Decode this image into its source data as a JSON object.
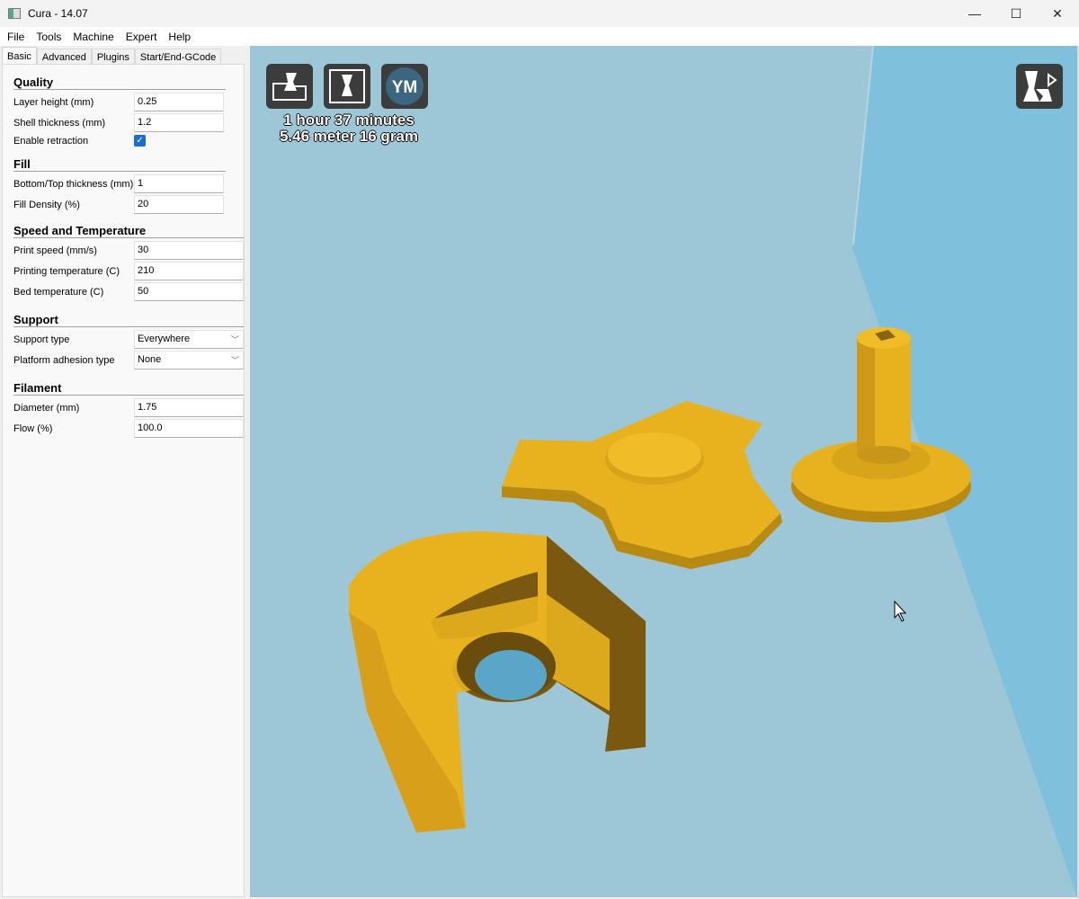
{
  "window": {
    "title": "Cura - 14.07",
    "minimize": "—",
    "maximize": "☐",
    "close": "✕"
  },
  "menu": [
    "File",
    "Tools",
    "Machine",
    "Expert",
    "Help"
  ],
  "tabs": [
    "Basic",
    "Advanced",
    "Plugins",
    "Start/End-GCode"
  ],
  "sections": {
    "quality": {
      "title": "Quality",
      "layer_height_label": "Layer height (mm)",
      "layer_height": "0.25",
      "shell_label": "Shell thickness (mm)",
      "shell": "1.2",
      "retraction_label": "Enable retraction",
      "retraction": true
    },
    "fill": {
      "title": "Fill",
      "bottom_top_label": "Bottom/Top thickness (mm)",
      "bottom_top": "1",
      "density_label": "Fill Density (%)",
      "density": "20"
    },
    "speed": {
      "title": "Speed and Temperature",
      "print_speed_label": "Print speed (mm/s)",
      "print_speed": "30",
      "print_temp_label": "Printing temperature (C)",
      "print_temp": "210",
      "bed_temp_label": "Bed temperature (C)",
      "bed_temp": "50"
    },
    "support": {
      "title": "Support",
      "type_label": "Support type",
      "type": "Everywhere",
      "adhesion_label": "Platform adhesion type",
      "adhesion": "None"
    },
    "filament": {
      "title": "Filament",
      "diameter_label": "Diameter (mm)",
      "diameter": "1.75",
      "flow_label": "Flow (%)",
      "flow": "100.0"
    }
  },
  "viewport": {
    "print_time": "1 hour 37 minutes",
    "material": "5.46 meter 16 gram",
    "ym_label": "YM",
    "model_color": "#e8b21e",
    "floor_light": "#6cc0e2",
    "floor_dark": "#56a8cc"
  },
  "icons": {
    "load": "load-model-icon",
    "prepare": "prepare-print-icon",
    "ym": "youmagine-icon",
    "view": "view-mode-icon"
  }
}
